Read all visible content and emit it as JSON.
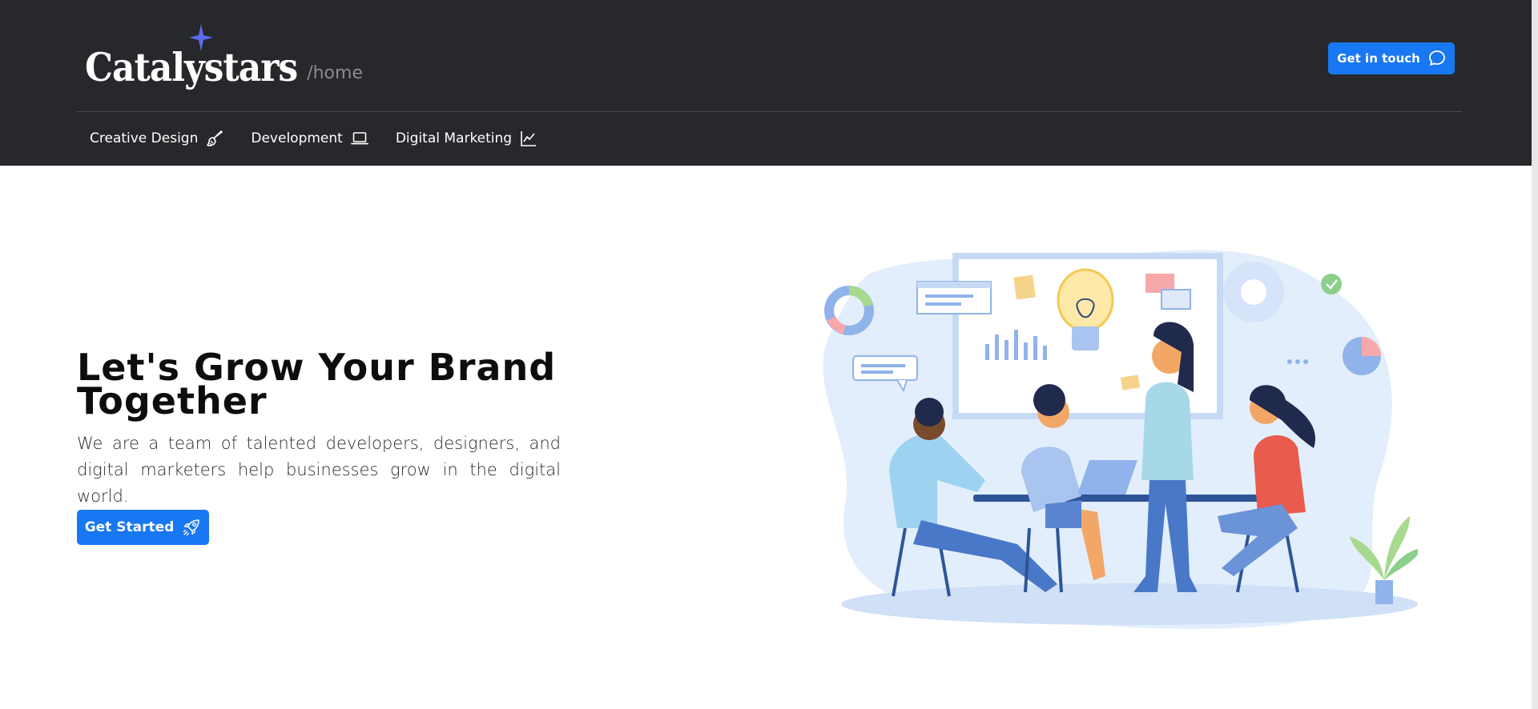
{
  "brand": {
    "logo_text": "Catalystars",
    "path": "/home"
  },
  "header": {
    "cta_label": "Get in touch",
    "cta_icon": "chat-bubble-icon"
  },
  "nav": {
    "items": [
      {
        "label": "Creative Design",
        "icon": "paintbrush-icon"
      },
      {
        "label": "Development",
        "icon": "laptop-icon"
      },
      {
        "label": "Digital Marketing",
        "icon": "line-chart-icon"
      }
    ]
  },
  "hero": {
    "title_line1": "Let's Grow Your Brand",
    "title_line2": "Together",
    "subtitle": "We are a team of talented developers, designers, and digital marketers help businesses grow in the digital world.",
    "cta_label": "Get Started",
    "cta_icon": "rocket-icon"
  },
  "colors": {
    "header_bg": "#27282b",
    "accent": "#1877f2",
    "star": "#5b6cf0"
  }
}
